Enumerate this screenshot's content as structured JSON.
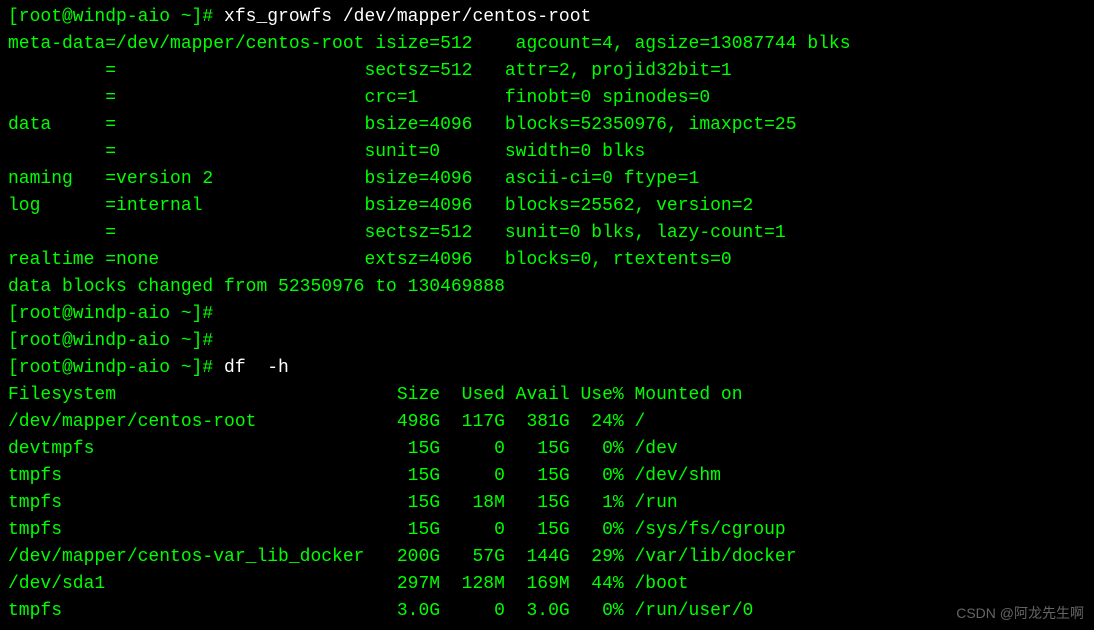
{
  "prompt1": "[root@windp-aio ~]# ",
  "cmd1": "xfs_growfs /dev/mapper/centos-root",
  "xfs": {
    "l1": "meta-data=/dev/mapper/centos-root isize=512    agcount=4, agsize=13087744 blks",
    "l2": "         =                       sectsz=512   attr=2, projid32bit=1",
    "l3": "         =                       crc=1        finobt=0 spinodes=0",
    "l4": "data     =                       bsize=4096   blocks=52350976, imaxpct=25",
    "l5": "         =                       sunit=0      swidth=0 blks",
    "l6": "naming   =version 2              bsize=4096   ascii-ci=0 ftype=1",
    "l7": "log      =internal               bsize=4096   blocks=25562, version=2",
    "l8": "         =                       sectsz=512   sunit=0 blks, lazy-count=1",
    "l9": "realtime =none                   extsz=4096   blocks=0, rtextents=0",
    "l10": "data blocks changed from 52350976 to 130469888"
  },
  "prompt_empty": "[root@windp-aio ~]# ",
  "prompt2": "[root@windp-aio ~]# ",
  "cmd2": "df  -h",
  "df": {
    "header": "Filesystem                          Size  Used Avail Use% Mounted on",
    "r1": "/dev/mapper/centos-root             498G  117G  381G  24% /",
    "r2": "devtmpfs                             15G     0   15G   0% /dev",
    "r3": "tmpfs                                15G     0   15G   0% /dev/shm",
    "r4": "tmpfs                                15G   18M   15G   1% /run",
    "r5": "tmpfs                                15G     0   15G   0% /sys/fs/cgroup",
    "r6": "/dev/mapper/centos-var_lib_docker   200G   57G  144G  29% /var/lib/docker",
    "r7": "/dev/sda1                           297M  128M  169M  44% /boot",
    "r8": "tmpfs                               3.0G     0  3.0G   0% /run/user/0"
  },
  "watermark": "CSDN @阿龙先生啊"
}
